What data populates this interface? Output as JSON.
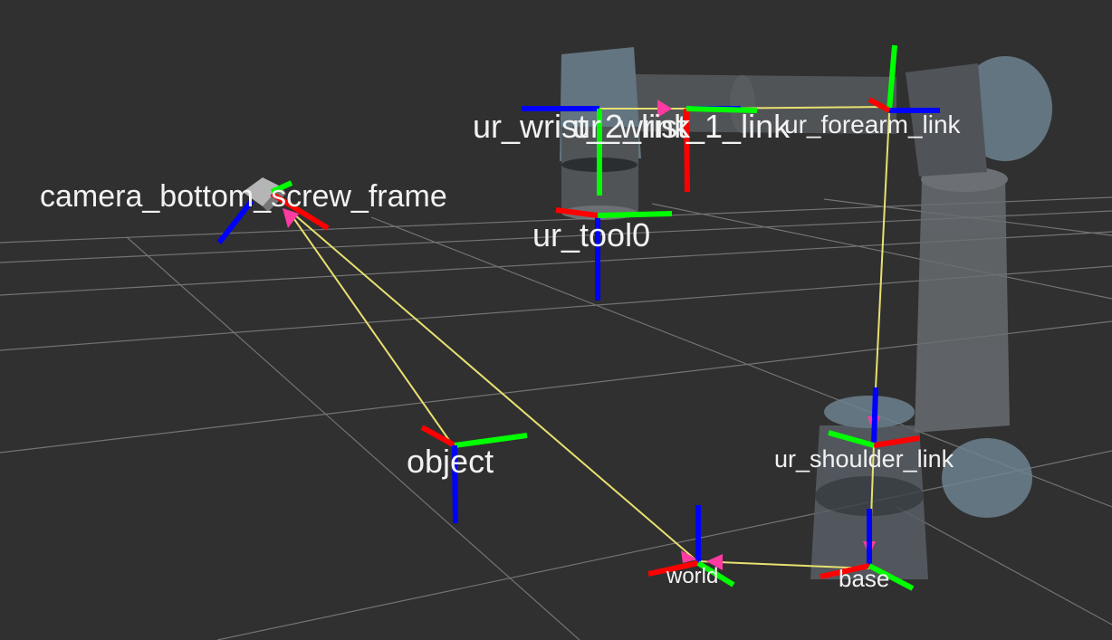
{
  "viewer": {
    "background_color": "#303030",
    "grid_color": "#8a8a8a",
    "tf_link_color": "#e8e070",
    "tf_arrow_color": "#ff3aa0",
    "axis_colors": {
      "x": "#ff0000",
      "y": "#00ff00",
      "z": "#0000ff"
    }
  },
  "frames": [
    {
      "id": "ur_wrist_2_link",
      "label": "ur_wrist_2_link"
    },
    {
      "id": "ur_wrist_1_link",
      "label": "ur_wrist_1_link"
    },
    {
      "id": "ur_forearm_link",
      "label": "ur_forearm_link"
    },
    {
      "id": "camera_bottom_screw_frame",
      "label": "camera_bottom_screw_frame"
    },
    {
      "id": "ur_tool0",
      "label": "ur_tool0"
    },
    {
      "id": "object",
      "label": "object"
    },
    {
      "id": "ur_shoulder_link",
      "label": "ur_shoulder_link"
    },
    {
      "id": "world",
      "label": "world"
    },
    {
      "id": "base",
      "label": "base"
    }
  ]
}
